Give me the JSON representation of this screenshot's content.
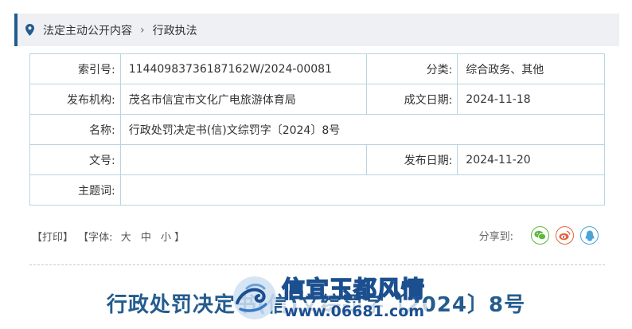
{
  "breadcrumb": {
    "items": [
      "法定主动公开内容",
      "行政执法"
    ],
    "separator": "›"
  },
  "meta": {
    "index_label": "索引号:",
    "index_value": "11440983736187162W/2024-00081",
    "category_label": "分类:",
    "category_value": "综合政务、其他",
    "publisher_label": "发布机构:",
    "publisher_value": "茂名市信宜市文化广电旅游体育局",
    "created_label": "成文日期:",
    "created_value": "2024-11-18",
    "name_label": "名称:",
    "name_value": "行政处罚决定书(信)文综罚字〔2024〕8号",
    "docno_label": "文号:",
    "docno_value": "",
    "published_label": "发布日期:",
    "published_value": "2024-11-20",
    "keywords_label": "主题词:",
    "keywords_value": ""
  },
  "tools": {
    "print": "【打印】",
    "font_open": "【字体:",
    "font_large": "大",
    "font_medium": "中",
    "font_small": "小",
    "font_close": "】"
  },
  "share": {
    "label": "分享到:",
    "icons": [
      "wechat-icon",
      "weibo-icon",
      "qq-icon"
    ]
  },
  "document": {
    "title": "行政处罚决定书(信)文综罚字〔2024〕8号"
  },
  "watermark": {
    "text": "信宜玉都风情",
    "url": "www.06681.com"
  },
  "colors": {
    "accent": "#245c8e",
    "table_border": "#b9d5df",
    "breadcrumb_bg": "#eef0f3"
  }
}
